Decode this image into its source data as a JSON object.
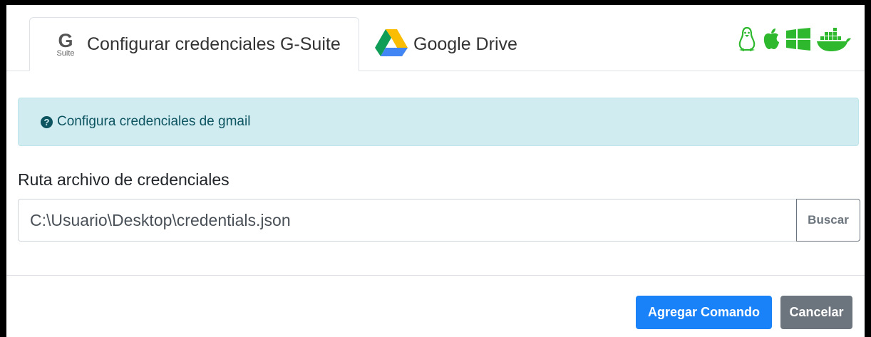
{
  "tabs": [
    {
      "label": "Configurar credenciales G-Suite",
      "icon": "gsuite-icon",
      "icon_letter": "G",
      "icon_caption": "Suite",
      "active": true
    },
    {
      "label": "Google Drive",
      "icon": "google-drive-icon",
      "active": false
    }
  ],
  "platform_icons": [
    "linux-icon",
    "apple-icon",
    "windows-icon",
    "docker-icon"
  ],
  "alert": {
    "icon": "question-circle-icon",
    "icon_glyph": "?",
    "text": "Configura credenciales de gmail"
  },
  "field": {
    "label": "Ruta archivo de credenciales",
    "value": "C:\\Usuario\\Desktop\\credentials.json",
    "browse_label": "Buscar"
  },
  "footer": {
    "submit_label": "Agregar Comando",
    "cancel_label": "Cancelar"
  },
  "colors": {
    "platform_icons": "#2eb82e",
    "primary": "#1a82f8",
    "secondary": "#6c757d",
    "alert_bg": "#d1ecf1",
    "alert_text": "#0c5460"
  }
}
